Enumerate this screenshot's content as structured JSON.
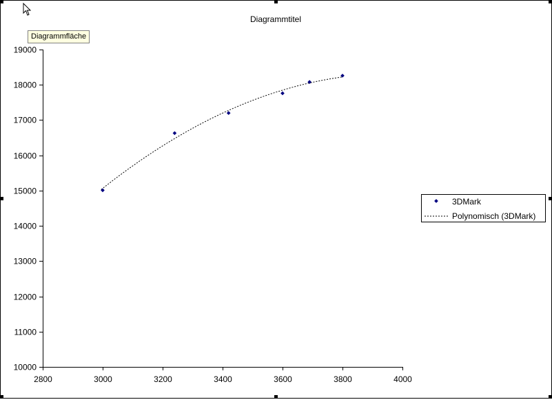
{
  "tooltip": "Diagrammfläche",
  "chart_data": {
    "type": "scatter",
    "title": "Diagrammtitel",
    "xlabel": "",
    "ylabel": "",
    "xlim": [
      2800,
      4000
    ],
    "ylim": [
      10000,
      19000
    ],
    "x_ticks": [
      2800,
      3000,
      3200,
      3400,
      3600,
      3800,
      4000
    ],
    "y_ticks": [
      10000,
      11000,
      12000,
      13000,
      14000,
      15000,
      16000,
      17000,
      18000,
      19000
    ],
    "grid": false,
    "legend_position": "right",
    "series": [
      {
        "name": "3DMark",
        "marker": "diamond",
        "color": "#000080",
        "points": [
          {
            "x": 3000,
            "y": 15010
          },
          {
            "x": 3240,
            "y": 16630
          },
          {
            "x": 3420,
            "y": 17200
          },
          {
            "x": 3600,
            "y": 17760
          },
          {
            "x": 3690,
            "y": 18080
          },
          {
            "x": 3800,
            "y": 18260
          }
        ]
      }
    ],
    "trendline": {
      "name": "Polynomisch (3DMark)",
      "type": "polynomial",
      "style": "dashed",
      "color": "#000000",
      "x_range": [
        2995,
        3800
      ]
    }
  }
}
